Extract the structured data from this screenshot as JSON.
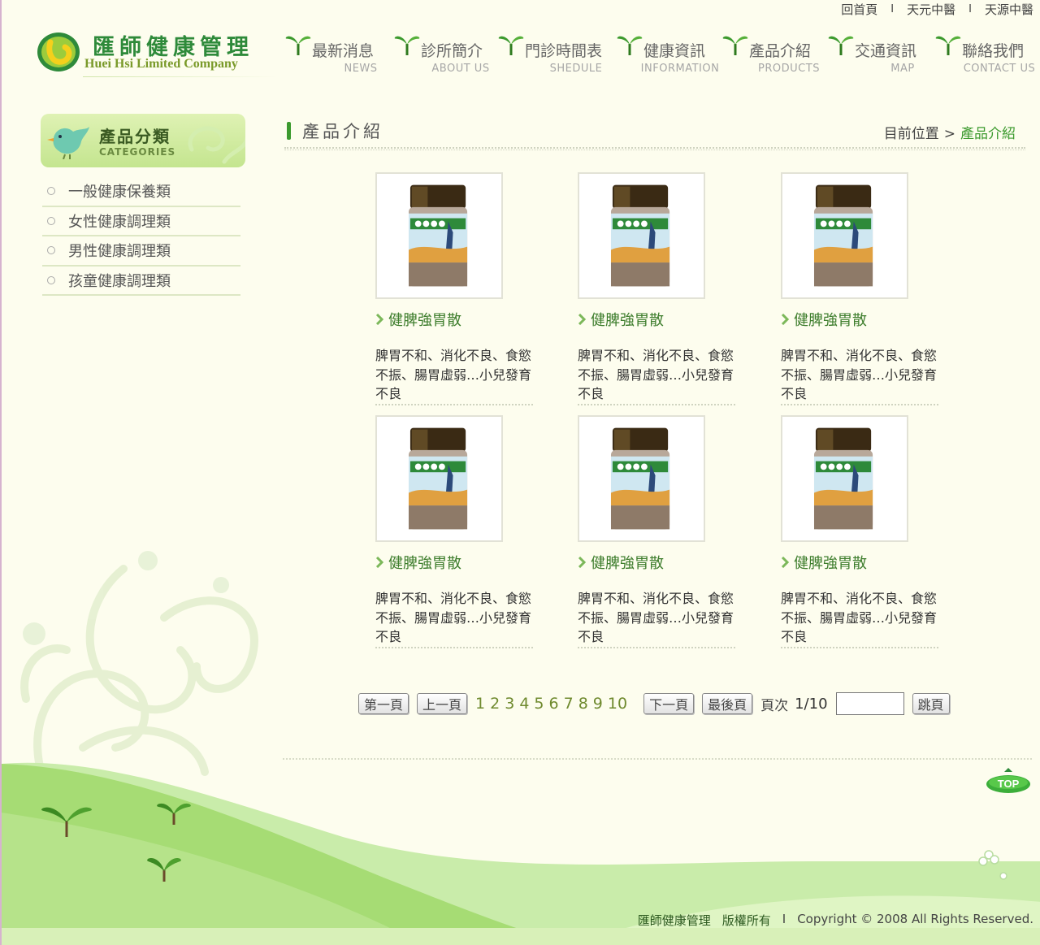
{
  "top_links": [
    "回首頁",
    "天元中醫",
    "天源中醫"
  ],
  "logo": {
    "cn": "匯師健康管理",
    "en": "Huei Hsi Limited Company"
  },
  "nav": [
    {
      "cn": "最新消息",
      "en": "NEWS"
    },
    {
      "cn": "診所簡介",
      "en": "ABOUT US"
    },
    {
      "cn": "門診時間表",
      "en": "SHEDULE"
    },
    {
      "cn": "健康資訊",
      "en": "INFORMATION"
    },
    {
      "cn": "產品介紹",
      "en": "PRODUCTS"
    },
    {
      "cn": "交通資訊",
      "en": "MAP"
    },
    {
      "cn": "聯絡我們",
      "en": "CONTACT US"
    }
  ],
  "sidebar": {
    "title": "產品分類",
    "subtitle": "CATEGORIES",
    "items": [
      "一般健康保養類",
      "女性健康調理類",
      "男性健康調理類",
      "孩童健康調理類"
    ]
  },
  "main": {
    "title": "產品介紹",
    "breadcrumb_label": "目前位置",
    "breadcrumb_arrow": ">",
    "breadcrumb_current": "產品介紹"
  },
  "products": [
    {
      "name": "健脾強胃散",
      "desc": "脾胃不和、消化不良、食慾不振、腸胃虛弱…小兒發育不良"
    },
    {
      "name": "健脾強胃散",
      "desc": "脾胃不和、消化不良、食慾不振、腸胃虛弱…小兒發育不良"
    },
    {
      "name": "健脾強胃散",
      "desc": "脾胃不和、消化不良、食慾不振、腸胃虛弱…小兒發育不良"
    },
    {
      "name": "健脾強胃散",
      "desc": "脾胃不和、消化不良、食慾不振、腸胃虛弱…小兒發育不良"
    },
    {
      "name": "健脾強胃散",
      "desc": "脾胃不和、消化不良、食慾不振、腸胃虛弱…小兒發育不良"
    },
    {
      "name": "健脾強胃散",
      "desc": "脾胃不和、消化不良、食慾不振、腸胃虛弱…小兒發育不良"
    }
  ],
  "pager": {
    "first": "第一頁",
    "prev": "上一頁",
    "pages": [
      "1",
      "2",
      "3",
      "4",
      "5",
      "6",
      "7",
      "8",
      "9",
      "10"
    ],
    "next": "下一頁",
    "last": "最後頁",
    "page_label": "頁次",
    "page_value": "1/10",
    "jump_value": "",
    "jump": "跳頁"
  },
  "top_button": "TOP",
  "footer": {
    "company": "匯師健康管理",
    "rights": "版權所有",
    "sep": "I",
    "copyright": "Copyright © 2008 All Rights Reserved."
  },
  "colors": {
    "background": "#fdfdee",
    "brand_green": "#3c9a2e",
    "hill_green": "#b6e38a"
  }
}
